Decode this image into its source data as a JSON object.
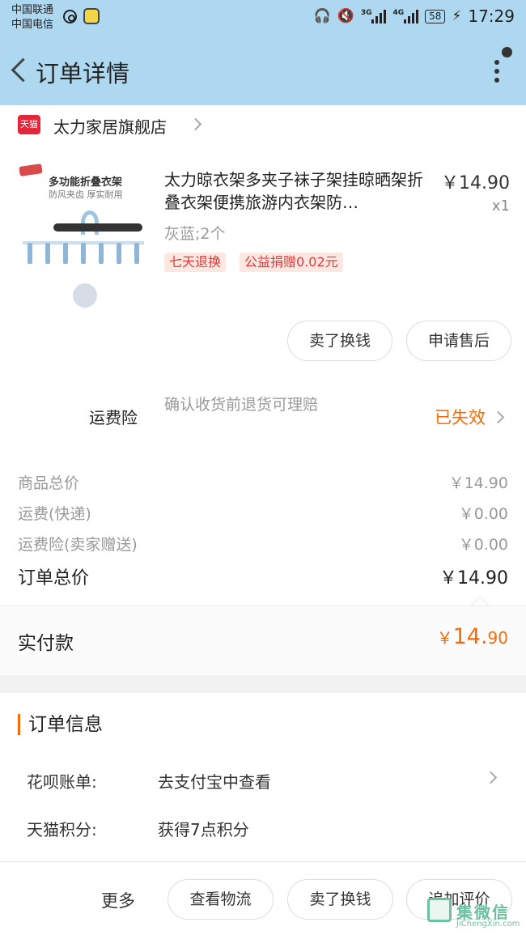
{
  "status_bar": {
    "carrier_1": "中国联通",
    "carrier_2": "中国电信",
    "network_tag_1": "3G",
    "network_tag_2": "4G",
    "battery": "58",
    "time": "17:29"
  },
  "header": {
    "title": "订单详情"
  },
  "store": {
    "logo_text": "天猫",
    "name": "太力家居旗舰店"
  },
  "product": {
    "image_title": "多功能折叠衣架",
    "image_subtitle": "防风夹齿 厚实耐用",
    "name": "太力晾衣架多夹子袜子架挂晾晒架折叠衣架便携旅游内衣架防…",
    "price": "￥14.90",
    "quantity": "x1",
    "variant": "灰蓝;2个",
    "tags": [
      "七天退换",
      "公益捐赠0.02元"
    ],
    "actions": [
      "卖了换钱",
      "申请售后"
    ]
  },
  "insurance": {
    "label": "运费险",
    "description": "确认收货前退货可理赔",
    "status": "已失效"
  },
  "summary": {
    "rows": [
      {
        "label": "商品总价",
        "value": "￥14.90"
      },
      {
        "label": "运费(快递)",
        "value": "￥0.00"
      },
      {
        "label": "运费险(卖家赠送)",
        "value": "￥0.00"
      }
    ],
    "total_label": "订单总价",
    "total_value": "￥14.90"
  },
  "paid": {
    "label": "实付款",
    "currency": "￥",
    "amount_int": "14.",
    "amount_dec": "90"
  },
  "order_info": {
    "title": "订单信息",
    "rows": [
      {
        "label": "花呗账单:",
        "value": "去支付宝中查看"
      },
      {
        "label": "天猫积分:",
        "value": "获得7点积分"
      }
    ]
  },
  "bottom_bar": {
    "more": "更多",
    "buttons": [
      "查看物流",
      "卖了换钱",
      "追加评价"
    ]
  },
  "watermark": {
    "text": "集微信",
    "sub": "JiChengXin.com"
  },
  "colors": {
    "header_bg": "#add8f0",
    "accent_orange": "#f46c0a",
    "tag_red": "#e4393c",
    "tmall_red": "#e4263a"
  }
}
